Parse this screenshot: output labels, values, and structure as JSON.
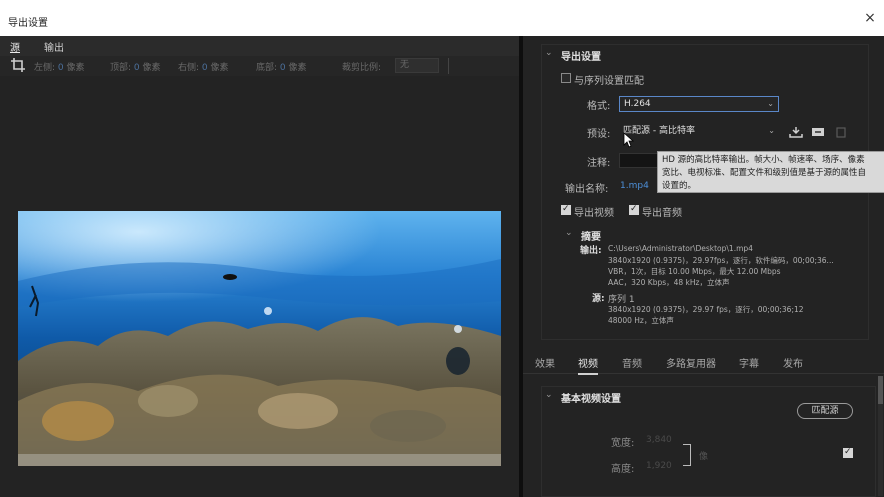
{
  "window": {
    "title": "导出设置",
    "close_label": "×"
  },
  "left_tabs": [
    "源",
    "输出"
  ],
  "crop_toolbar": {
    "fields": [
      {
        "label": "左侧:",
        "value": "0",
        "unit": "像素"
      },
      {
        "label": "顶部:",
        "value": "0",
        "unit": "像素"
      },
      {
        "label": "右侧:",
        "value": "0",
        "unit": "像素"
      },
      {
        "label": "底部:",
        "value": "0",
        "unit": "像素"
      }
    ],
    "ratio_label": "裁剪比例:",
    "ratio_value": "无"
  },
  "export_settings": {
    "title": "导出设置",
    "match_sequence_label": "与序列设置匹配",
    "format_label": "格式:",
    "format_value": "H.264",
    "preset_label": "预设:",
    "preset_value": "匹配源 - 高比特率",
    "comment_label": "注释:",
    "output_name_label": "输出名称:",
    "output_name_value": "1.mp4",
    "export_video_label": "导出视频",
    "export_audio_label": "导出音频",
    "tooltip_lines": [
      "HD 源的高比特率输出。帧大小、帧速率、场序、像素",
      "宽比、电视标准、配置文件和级别值是基于源的属性自",
      "设置的。"
    ]
  },
  "summary": {
    "title": "摘要",
    "output_label": "输出:",
    "output_lines": [
      "C:\\Users\\Administrator\\Desktop\\1.mp4",
      "3840x1920 (0.9375)，29.97fps，逐行，软件编码，00;00;36...",
      "VBR，1次，目标 10.00 Mbps，最大 12.00 Mbps",
      "AAC，320 Kbps，48 kHz，立体声"
    ],
    "source_label": "源:",
    "source_lines": [
      "序列 1",
      "3840x1920 (0.9375)，29.97 fps，逐行，00;00;36;12",
      "48000 Hz，立体声"
    ]
  },
  "settings_tabs": [
    "效果",
    "视频",
    "音频",
    "多路复用器",
    "字幕",
    "发布"
  ],
  "active_settings_tab": 1,
  "basic_video": {
    "title": "基本视频设置",
    "match_source_button": "匹配源",
    "width_label": "宽度:",
    "width_value": "3,840",
    "height_label": "高度:",
    "height_value": "1,920",
    "link_unit": "像"
  },
  "colors": {
    "accent": "#5a87c8",
    "link": "#4d8fd8",
    "panel": "#232323"
  }
}
